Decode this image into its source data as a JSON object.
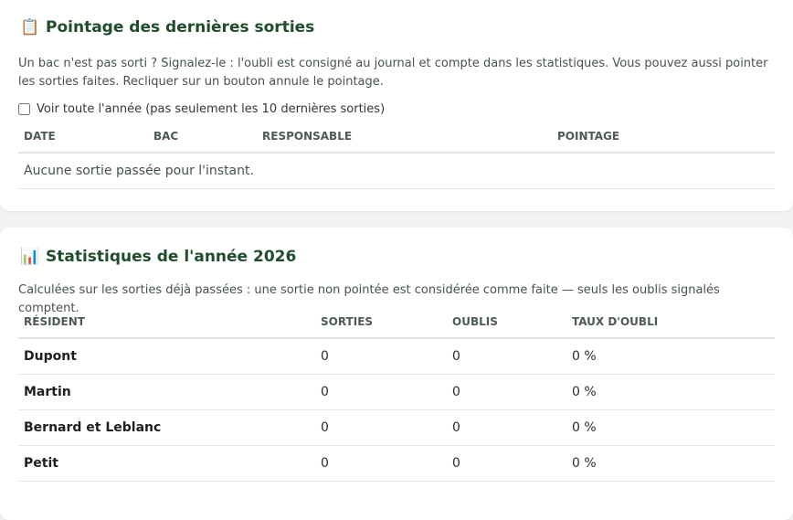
{
  "pointage": {
    "icon": "clipboard-icon",
    "title": "Pointage des dernières sorties",
    "description": "Un bac n'est pas sorti ? Signalez-le : l'oubli est consigné au journal et compte dans les statistiques. Vous pouvez aussi pointer les sorties faites. Recliquer sur un bouton annule le pointage.",
    "checkbox_label": "Voir toute l'année (pas seulement les 10 dernières sorties)",
    "checkbox_checked": false,
    "columns": [
      "DATE",
      "BAC",
      "RESPONSABLE",
      "POINTAGE"
    ],
    "empty_message": "Aucune sortie passée pour l'instant."
  },
  "stats": {
    "icon": "bar-chart-icon",
    "title": "Statistiques de l'année 2026",
    "description": "Calculées sur les sorties déjà passées : une sortie non pointée est considérée comme faite — seuls les oublis signalés comptent.",
    "columns": [
      "RÉSIDENT",
      "SORTIES",
      "OUBLIS",
      "TAUX D'OUBLI"
    ],
    "rows": [
      {
        "resident": "Dupont",
        "sorties": "0",
        "oublis": "0",
        "taux": "0 %"
      },
      {
        "resident": "Martin",
        "sorties": "0",
        "oublis": "0",
        "taux": "0 %"
      },
      {
        "resident": "Bernard et Leblanc",
        "sorties": "0",
        "oublis": "0",
        "taux": "0 %"
      },
      {
        "resident": "Petit",
        "sorties": "0",
        "oublis": "0",
        "taux": "0 %"
      }
    ]
  }
}
